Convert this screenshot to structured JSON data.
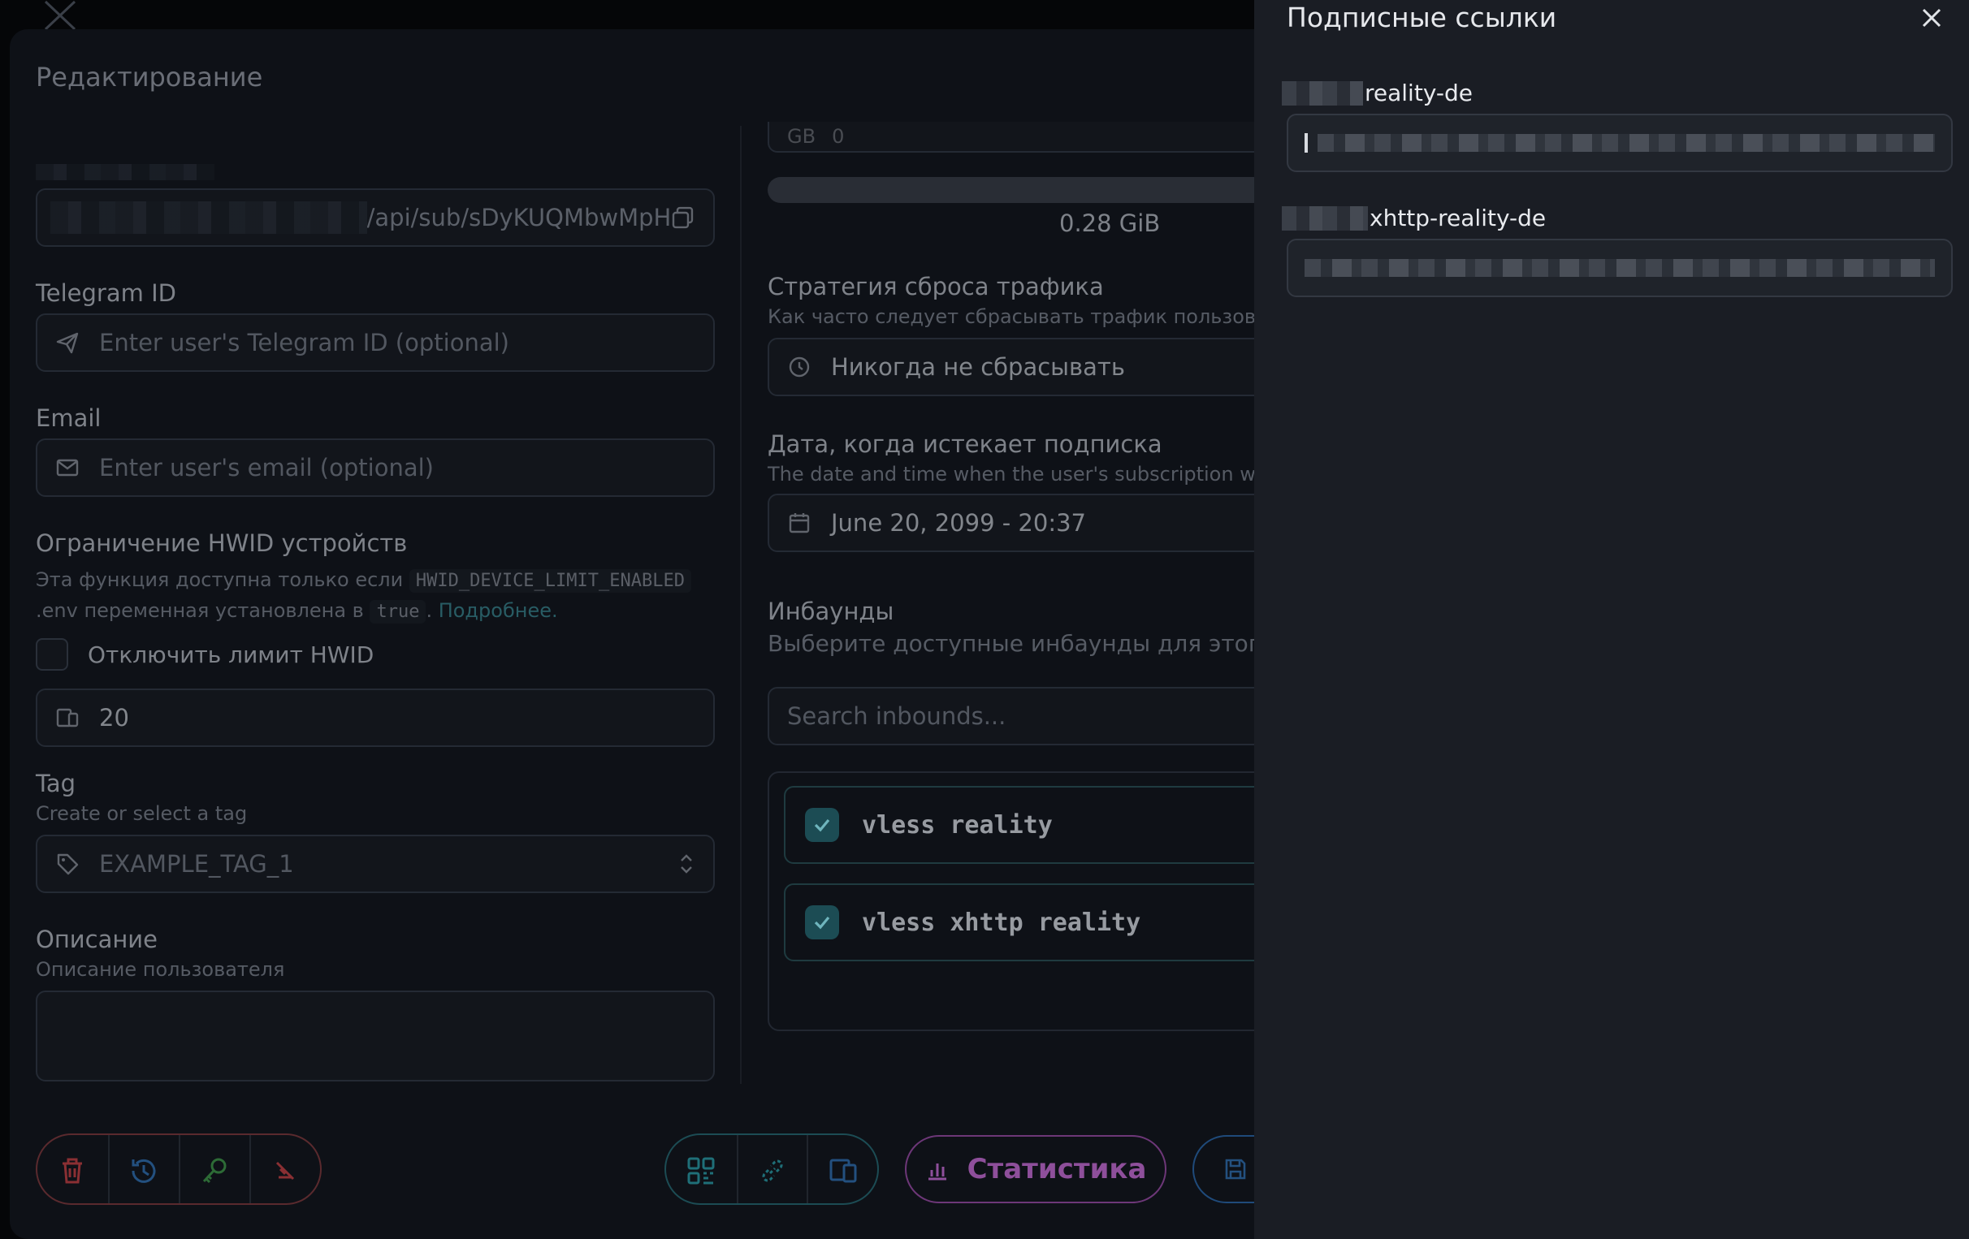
{
  "modal": {
    "title": "Редактирование",
    "sub_url_tail": "/api/sub/sDyKUQMbwMpH",
    "telegram": {
      "label": "Telegram ID",
      "placeholder": "Enter user's Telegram ID (optional)"
    },
    "email": {
      "label": "Email",
      "placeholder": "Enter user's email (optional)"
    },
    "hwid": {
      "label": "Ограничение HWID устройств",
      "desc_part1": "Эта функция доступна только если",
      "env_var": "HWID_DEVICE_LIMIT_ENABLED",
      "desc_part2": ".env переменная установлена в",
      "true_value": "true",
      "more_link": "Подробнее.",
      "disable_label": "Отключить лимит HWID",
      "limit_value": "20"
    },
    "tag": {
      "label": "Tag",
      "hint": "Create or select a tag",
      "placeholder": "EXAMPLE_TAG_1"
    },
    "description": {
      "label": "Описание",
      "hint": "Описание пользователя"
    },
    "traffic": {
      "unit": "GB",
      "value": "0",
      "used": "0.28 GiB",
      "strategy_label": "Стратегия сброса трафика",
      "strategy_hint": "Как часто следует сбрасывать трафик пользовател",
      "strategy_value": "Никогда не сбрасывать"
    },
    "expire": {
      "label": "Дата, когда истекает подписка",
      "hint": "The date and time when the user's subscription w",
      "value": "June 20, 2099 - 20:37"
    },
    "inbounds": {
      "label": "Инбаунды",
      "hint": "Выберите доступные инбаунды для этого",
      "search_placeholder": "Search inbounds...",
      "items": [
        {
          "name": "vless reality"
        },
        {
          "name": "vless xhttp reality"
        }
      ]
    },
    "stats_button": "Статистика"
  },
  "drawer": {
    "title": "Подписные ссылки",
    "links": [
      {
        "label": "reality-de"
      },
      {
        "label": "xhttp-reality-de"
      }
    ]
  },
  "colors": {
    "drawer_bg": "#1a1d24",
    "delete": "#c0393b",
    "history": "#2b6cb0",
    "key": "#3a9a4a",
    "accent_teal": "#1f6f78",
    "stats": "#8e4f9b"
  }
}
